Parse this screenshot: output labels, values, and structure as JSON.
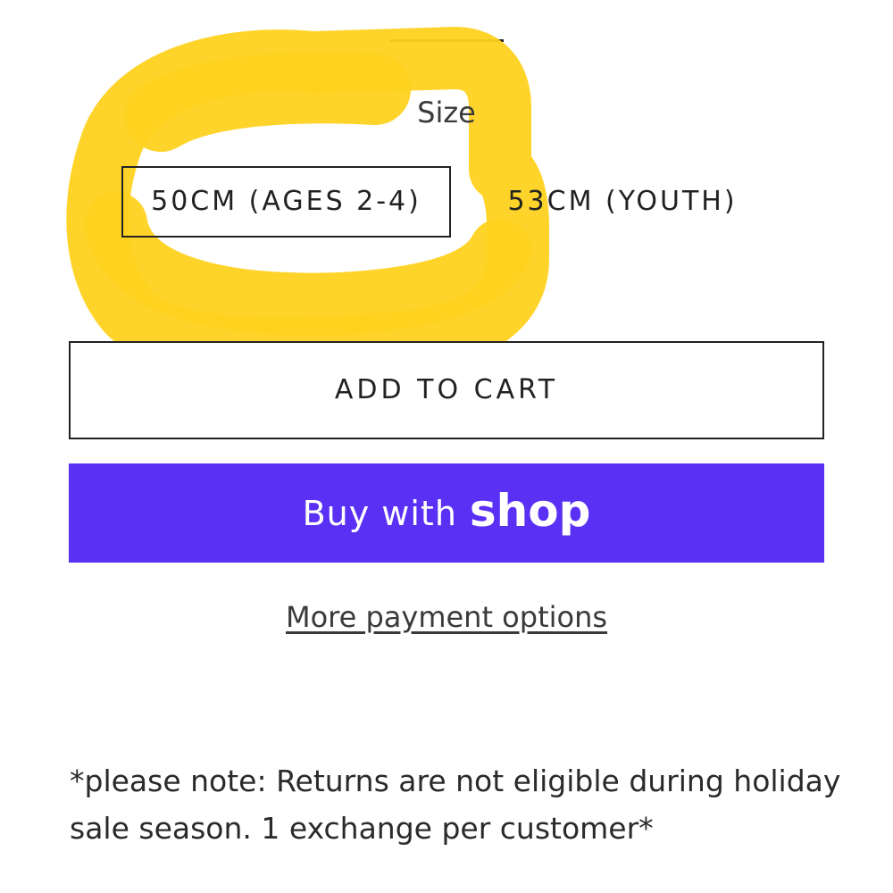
{
  "size_selector": {
    "label": "Size",
    "options": [
      {
        "label": "50CM (AGES 2-4)",
        "selected": true
      },
      {
        "label": "53CM (YOUTH)",
        "selected": false
      }
    ]
  },
  "actions": {
    "add_to_cart": "ADD TO CART",
    "buy_with_prefix": "Buy with",
    "shop_brand": "shop",
    "more_payment_options": "More payment options"
  },
  "note": "*please note: Returns are not eligible during holiday sale season. 1 exchange per customer*",
  "colors": {
    "shop_purple": "#5a31f4",
    "highlight_yellow": "#ffd21f",
    "border": "#222222"
  }
}
